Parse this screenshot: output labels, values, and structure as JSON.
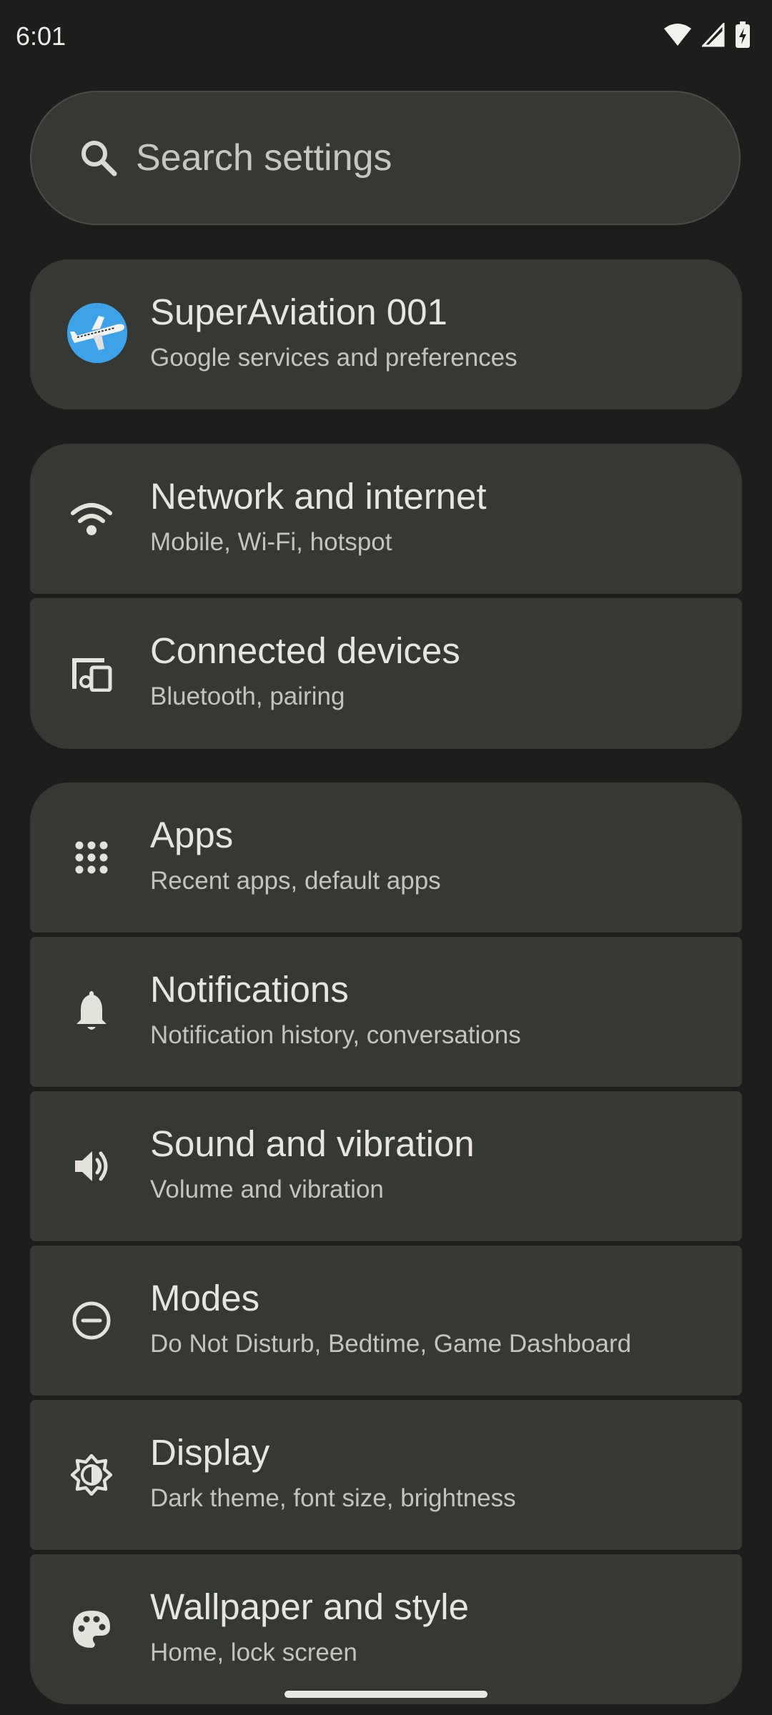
{
  "status_bar": {
    "time": "6:01",
    "icons": [
      "wifi-icon",
      "cell-signal-icon",
      "battery-charging-icon"
    ]
  },
  "search": {
    "placeholder": "Search settings",
    "icon": "search-icon"
  },
  "account": {
    "name": "SuperAviation 001",
    "subtitle": "Google services and preferences",
    "avatar_color": "#3ea2e8"
  },
  "settings_groups": [
    {
      "items": [
        {
          "title": "Network and internet",
          "subtitle": "Mobile, Wi‑Fi, hotspot",
          "icon": "wifi-icon"
        },
        {
          "title": "Connected devices",
          "subtitle": "Bluetooth, pairing",
          "icon": "devices-icon"
        }
      ]
    },
    {
      "items": [
        {
          "title": "Apps",
          "subtitle": "Recent apps, default apps",
          "icon": "apps-grid-icon"
        },
        {
          "title": "Notifications",
          "subtitle": "Notification history, conversations",
          "icon": "bell-icon"
        },
        {
          "title": "Sound and vibration",
          "subtitle": "Volume and vibration",
          "icon": "volume-icon"
        },
        {
          "title": "Modes",
          "subtitle": "Do Not Disturb, Bedtime, Game Dashboard",
          "icon": "do-not-disturb-icon"
        },
        {
          "title": "Display",
          "subtitle": "Dark theme, font size, brightness",
          "icon": "brightness-icon"
        },
        {
          "title": "Wallpaper and style",
          "subtitle": "Home, lock screen",
          "icon": "palette-icon"
        }
      ]
    }
  ],
  "colors": {
    "background": "#1c1e1b",
    "card": "#353833",
    "text_primary": "#e6e6df",
    "text_secondary": "#c2c5bc",
    "icon": "#e3e3dc"
  }
}
